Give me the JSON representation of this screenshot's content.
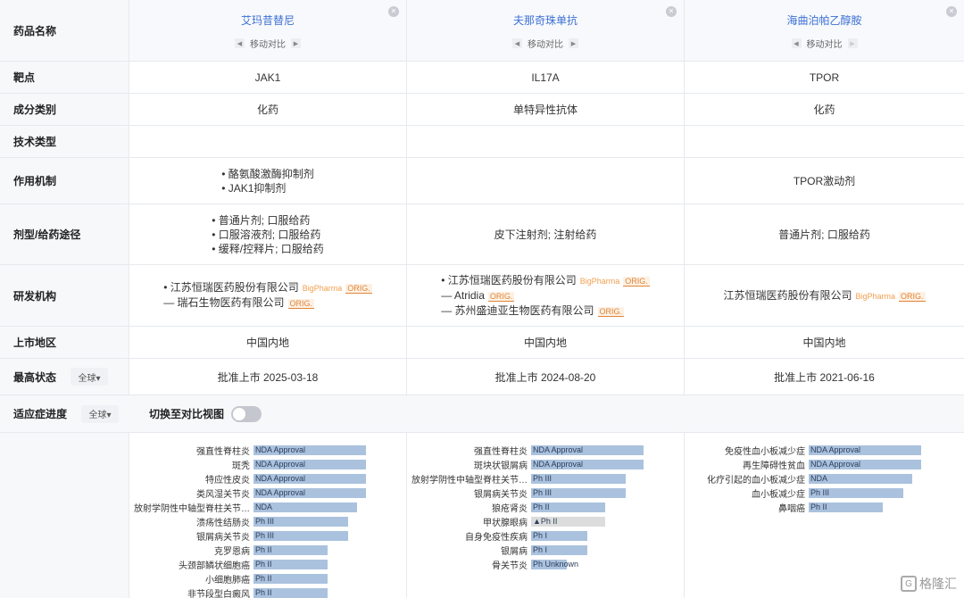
{
  "labels": {
    "drug_name": "药品名称",
    "target": "靶点",
    "component": "成分类别",
    "tech": "技术类型",
    "mechanism": "作用机制",
    "dosage": "剂型/给药途径",
    "org": "研发机构",
    "region": "上市地区",
    "status": "最高状态",
    "scope": "全球▾",
    "progress": "适应症进度",
    "switch": "切换至对比视图"
  },
  "move_label": "移动对比",
  "drugs": [
    {
      "name": "艾玛昔替尼",
      "target": "JAK1",
      "component": "化药",
      "tech": "",
      "mechanism": [
        "• 酪氨酸激酶抑制剂",
        "• JAK1抑制剂"
      ],
      "dosage": [
        "• 普通片剂; 口服给药",
        "• 口服溶液剂; 口服给药",
        "• 缓释/控释片; 口服给药"
      ],
      "orgs": [
        {
          "name": "• 江苏恒瑞医药股份有限公司",
          "tag": "BigPharma",
          "orig": "ORIG."
        },
        {
          "name": "— 瑞石生物医药有限公司",
          "tag": "",
          "orig": "ORIG."
        }
      ],
      "region": "中国内地",
      "status": "批准上市 2025-03-18",
      "indications": [
        {
          "name": "强直性脊柱炎",
          "phase": "NDA Approval",
          "level": 1.0
        },
        {
          "name": "斑秃",
          "phase": "NDA Approval",
          "level": 1.0
        },
        {
          "name": "特应性皮炎",
          "phase": "NDA Approval",
          "level": 1.0
        },
        {
          "name": "类风湿关节炎",
          "phase": "NDA Approval",
          "level": 1.0
        },
        {
          "name": "放射学阴性中轴型脊柱关节…",
          "phase": "NDA",
          "level": 0.92
        },
        {
          "name": "溃疡性结肠炎",
          "phase": "Ph III",
          "level": 0.84
        },
        {
          "name": "银屑病关节炎",
          "phase": "Ph III",
          "level": 0.84
        },
        {
          "name": "克罗恩病",
          "phase": "Ph II",
          "level": 0.66
        },
        {
          "name": "头颈部鳞状细胞癌",
          "phase": "Ph II",
          "level": 0.66
        },
        {
          "name": "小细胞肺癌",
          "phase": "Ph II",
          "level": 0.66
        },
        {
          "name": "非节段型白癜风",
          "phase": "Ph II",
          "level": 0.66
        }
      ]
    },
    {
      "name": "夫那奇珠单抗",
      "target": "IL17A",
      "component": "单特异性抗体",
      "tech": "",
      "mechanism": [],
      "dosage": [
        "皮下注射剂; 注射给药"
      ],
      "orgs": [
        {
          "name": "• 江苏恒瑞医药股份有限公司",
          "tag": "BigPharma",
          "orig": "ORIG."
        },
        {
          "name": "— Atridia",
          "tag": "",
          "orig": "ORIG."
        },
        {
          "name": "— 苏州盛迪亚生物医药有限公司",
          "tag": "",
          "orig": "ORIG."
        }
      ],
      "region": "中国内地",
      "status": "批准上市 2024-08-20",
      "indications": [
        {
          "name": "强直性脊柱炎",
          "phase": "NDA Approval",
          "level": 1.0
        },
        {
          "name": "斑块状银屑病",
          "phase": "NDA Approval",
          "level": 1.0
        },
        {
          "name": "放射学阴性中轴型脊柱关节…",
          "phase": "Ph III",
          "level": 0.84
        },
        {
          "name": "银屑病关节炎",
          "phase": "Ph III",
          "level": 0.84
        },
        {
          "name": "狼疮肾炎",
          "phase": "Ph II",
          "level": 0.66
        },
        {
          "name": "甲状腺眼病",
          "phase": "▲Ph II",
          "level": 0.66,
          "gray": true
        },
        {
          "name": "自身免疫性疾病",
          "phase": "Ph I",
          "level": 0.5
        },
        {
          "name": "银屑病",
          "phase": "Ph I",
          "level": 0.5
        },
        {
          "name": "骨关节炎",
          "phase": "Ph Unknown",
          "level": 0.32
        }
      ]
    },
    {
      "name": "海曲泊帕乙醇胺",
      "target": "TPOR",
      "component": "化药",
      "tech": "",
      "mechanism": [
        "TPOR激动剂"
      ],
      "dosage": [
        "普通片剂; 口服给药"
      ],
      "orgs": [
        {
          "name": "江苏恒瑞医药股份有限公司",
          "tag": "BigPharma",
          "orig": "ORIG."
        }
      ],
      "region": "中国内地",
      "status": "批准上市 2021-06-16",
      "indications": [
        {
          "name": "免疫性血小板减少症",
          "phase": "NDA Approval",
          "level": 1.0
        },
        {
          "name": "再生障碍性贫血",
          "phase": "NDA Approval",
          "level": 1.0
        },
        {
          "name": "化疗引起的血小板减少症",
          "phase": "NDA",
          "level": 0.92
        },
        {
          "name": "血小板减少症",
          "phase": "Ph III",
          "level": 0.84
        },
        {
          "name": "鼻咽癌",
          "phase": "Ph II",
          "level": 0.66
        }
      ]
    }
  ],
  "watermark": "格隆汇"
}
